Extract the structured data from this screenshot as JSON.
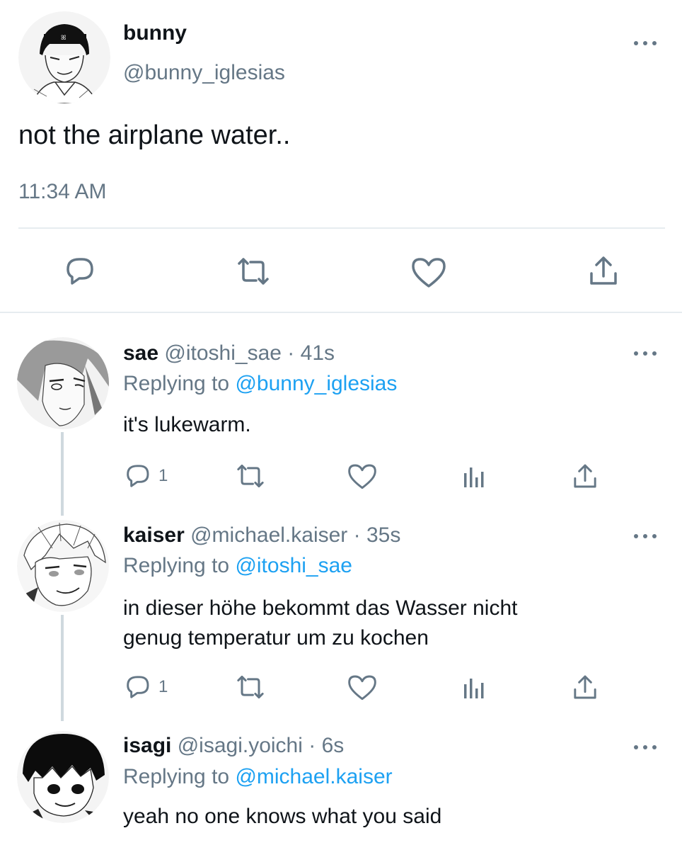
{
  "main_tweet": {
    "name": "bunny",
    "handle": "@bunny_iglesias",
    "text": "not the airplane water..",
    "time": "11:34 AM"
  },
  "replies": [
    {
      "name": "sae",
      "handle": "@itoshi_sae",
      "separator": "·",
      "time": "41s",
      "replying_label": "Replying to",
      "replying_to": "@bunny_iglesias",
      "text": "it's lukewarm.",
      "reply_count": "1"
    },
    {
      "name": "kaiser",
      "handle": "@michael.kaiser",
      "separator": "·",
      "time": "35s",
      "replying_label": "Replying to",
      "replying_to": "@itoshi_sae",
      "text_line1": "in dieser höhe bekommt das Wasser nicht",
      "text_line2": "genug temperatur um zu kochen",
      "reply_count": "1"
    },
    {
      "name": "isagi",
      "handle": "@isagi.yoichi",
      "separator": "·",
      "time": "6s",
      "replying_label": "Replying to",
      "replying_to": "@michael.kaiser",
      "text": "yeah no one knows what you said"
    }
  ],
  "icons": {
    "reply": "speech-bubble-icon",
    "retweet": "retweet-icon",
    "like": "heart-icon",
    "share": "share-icon",
    "analytics": "bar-chart-icon",
    "more": "ellipsis-icon"
  },
  "colors": {
    "text": "#0f1419",
    "muted": "#657786",
    "link": "#1da1f2",
    "divider": "#e6ecf0"
  }
}
